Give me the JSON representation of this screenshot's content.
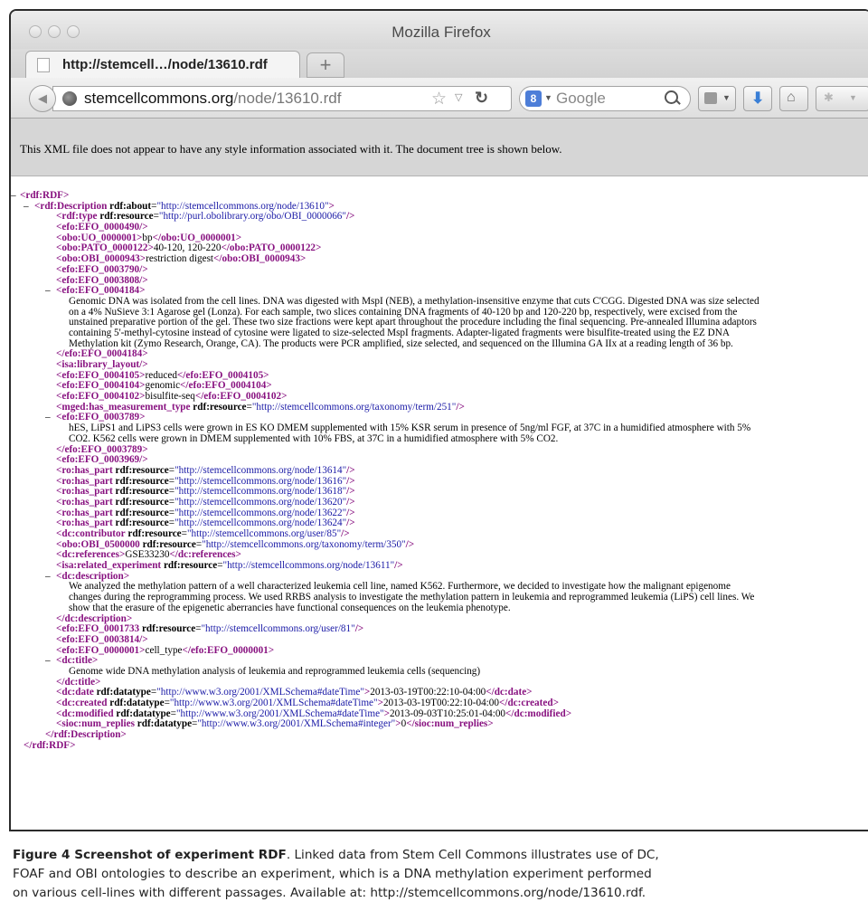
{
  "window": {
    "title": "Mozilla Firefox",
    "tab_title": "http://stemcell…/node/13610.rdf",
    "new_tab": "+",
    "url_domain": "stemcellcommons.org",
    "url_path": "/node/13610.rdf",
    "search_engine": "Google",
    "search_badge": "8"
  },
  "notice": "This XML file does not appear to have any style information associated with it. The document tree is shown below.",
  "xml": {
    "root_open": "<rdf:RDF>",
    "root_close": "</rdf:RDF>",
    "desc_open": "<rdf:Description",
    "desc_about_attr": "rdf:about",
    "desc_about_val": "\"http://stemcellcommons.org/node/13610\"",
    "desc_close": "</rdf:Description>",
    "type_tag": "<rdf:type",
    "type_attr": "rdf:resource",
    "type_val": "\"http://purl.obolibrary.org/obo/OBI_0000066\"",
    "efo490": "<efo:EFO_0000490/>",
    "uo_open": "<obo:UO_0000001>",
    "uo_text": "bp",
    "uo_close": "</obo:UO_0000001>",
    "pato_open": "<obo:PATO_0000122>",
    "pato_text": "40-120, 120-220",
    "pato_close": "</obo:PATO_0000122>",
    "obi943_open": "<obo:OBI_0000943>",
    "obi943_text": "restriction digest",
    "obi943_close": "</obo:OBI_0000943>",
    "efo3790": "<efo:EFO_0003790/>",
    "efo3808": "<efo:EFO_0003808/>",
    "efo4184_open": "<efo:EFO_0004184>",
    "efo4184_lines": [
      "Genomic DNA was isolated from the cell lines. DNA was digested with MspI (NEB), a methylation-insensitive enzyme that cuts C'CGG. Digested DNA was size selected",
      "on a 4% NuSieve 3:1 Agarose gel (Lonza). For each sample, two slices containing DNA fragments of 40-120 bp and 120-220 bp, respectively, were excised from the",
      "unstained preparative portion of the gel. These two size fractions were kept apart throughout the procedure including the final sequencing. Pre-annealed Illumina adaptors",
      "containing 5'-methyl-cytosine instead of cytosine were ligated to size-selected MspI fragments. Adapter-ligated fragments were bisulfite-treated using the EZ DNA",
      "Methylation kit (Zymo Research, Orange, CA). The products were PCR amplified, size selected, and sequenced on the Illumina GA IIx at a reading length of 36 bp."
    ],
    "efo4184_close": "</efo:EFO_0004184>",
    "isa_layout": "<isa:library_layout/>",
    "efo4105_open": "<efo:EFO_0004105>",
    "efo4105_text": "reduced",
    "efo4105_close": "</efo:EFO_0004105>",
    "efo4104_open": "<efo:EFO_0004104>",
    "efo4104_text": "genomic",
    "efo4104_close": "</efo:EFO_0004104>",
    "efo4102_open": "<efo:EFO_0004102>",
    "efo4102_text": "bisulfite-seq",
    "efo4102_close": "</efo:EFO_0004102>",
    "mged_tag": "<mged:has_measurement_type",
    "mged_attr": "rdf:resource",
    "mged_val": "\"http://stemcellcommons.org/taxonomy/term/251\"",
    "efo3789_open": "<efo:EFO_0003789>",
    "efo3789_lines": [
      "hES, LiPS1 and LiPS3 cells were grown in ES KO DMEM supplemented with 15% KSR serum in presence of 5ng/ml FGF, at 37C in a humidified atmosphere with 5%",
      "CO2. K562 cells were grown in DMEM supplemented with 10% FBS, at 37C in a humidified atmosphere with 5% CO2."
    ],
    "efo3789_close": "</efo:EFO_0003789>",
    "efo3969": "<efo:EFO_0003969/>",
    "has_part_tag": "<ro:has_part",
    "has_part_attr": "rdf:resource",
    "has_part_vals": [
      "\"http://stemcellcommons.org/node/13614\"",
      "\"http://stemcellcommons.org/node/13616\"",
      "\"http://stemcellcommons.org/node/13618\"",
      "\"http://stemcellcommons.org/node/13620\"",
      "\"http://stemcellcommons.org/node/13622\"",
      "\"http://stemcellcommons.org/node/13624\""
    ],
    "contrib_tag": "<dc:contributor",
    "contrib_attr": "rdf:resource",
    "contrib_val": "\"http://stemcellcommons.org/user/85\"",
    "obi500_tag": "<obo:OBI_0500000",
    "obi500_attr": "rdf:resource",
    "obi500_val": "\"http://stemcellcommons.org/taxonomy/term/350\"",
    "refs_open": "<dc:references>",
    "refs_text": "GSE33230",
    "refs_close": "</dc:references>",
    "isa_rel_tag": "<isa:related_experiment",
    "isa_rel_attr": "rdf:resource",
    "isa_rel_val": "\"http://stemcellcommons.org/node/13611\"",
    "dcdesc_open": "<dc:description>",
    "dcdesc_lines": [
      "We analyzed the methylation pattern of a well characterized leukemia cell line, named K562. Furthermore, we decided to investigate how the malignant epigenome",
      "changes during the reprogramming process. We used RRBS analysis to investigate the methylation pattern in leukemia and reprogrammed leukemia (LiPS) cell lines. We",
      "show that the erasure of the epigenetic aberrancies have functional consequences on the leukemia phenotype."
    ],
    "dcdesc_close": "</dc:description>",
    "efo1733_tag": "<efo:EFO_0001733",
    "efo1733_attr": "rdf:resource",
    "efo1733_val": "\"http://stemcellcommons.org/user/81\"",
    "efo3814": "<efo:EFO_0003814/>",
    "efo0001_open": "<efo:EFO_0000001>",
    "efo0001_text": "cell_type",
    "efo0001_close": "</efo:EFO_0000001>",
    "dctitle_open": "<dc:title>",
    "dctitle_text": "Genome wide DNA methylation analysis of leukemia and reprogrammed leukemia cells (sequencing)",
    "dctitle_close": "</dc:title>",
    "dcdate_tag": "<dc:date",
    "dcdate_attr": "rdf:datatype",
    "dcdate_val": "\"http://www.w3.org/2001/XMLSchema#dateTime\"",
    "dcdate_text": "2013-03-19T00:22:10-04:00",
    "dcdate_close": "</dc:date>",
    "dccreated_tag": "<dc:created",
    "dccreated_attr": "rdf:datatype",
    "dccreated_val": "\"http://www.w3.org/2001/XMLSchema#dateTime\"",
    "dccreated_text": "2013-03-19T00:22:10-04:00",
    "dccreated_close": "</dc:created>",
    "dcmod_tag": "<dc:modified",
    "dcmod_attr": "rdf:datatype",
    "dcmod_val": "\"http://www.w3.org/2001/XMLSchema#dateTime\"",
    "dcmod_text": "2013-09-03T10:25:01-04:00",
    "dcmod_close": "</dc:modified>",
    "sioc_tag": "<sioc:num_replies",
    "sioc_attr": "rdf:datatype",
    "sioc_val": "\"http://www.w3.org/2001/XMLSchema#integer\"",
    "sioc_text": "0",
    "sioc_close": "</sioc:num_replies>",
    "collapse": "–",
    "gt": ">",
    "self_close": "/>",
    "eq": "="
  },
  "caption": {
    "label": "Figure 4 Screenshot of experiment RDF",
    "text_lines": [
      ". Linked data from Stem Cell Commons illustrates use of DC,",
      "FOAF and OBI ontologies to describe an experiment, which is a DNA methylation experiment performed",
      "on various cell-lines with different passages. Available at: http://stemcellcommons.org/node/13610.rdf."
    ]
  }
}
